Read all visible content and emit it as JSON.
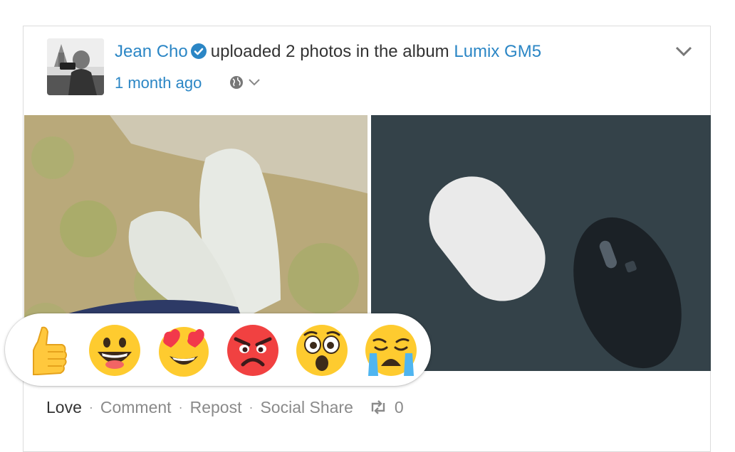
{
  "post": {
    "author": "Jean Cho",
    "action_text": "uploaded 2 photos in the album",
    "album": "Lumix GM5",
    "time": "1 month ago",
    "privacy_icon": "globe-icon"
  },
  "reactions": [
    "like",
    "haha",
    "love",
    "angry",
    "wow",
    "sad"
  ],
  "actions": {
    "love": "Love",
    "comment": "Comment",
    "repost": "Repost",
    "share": "Social Share",
    "repost_count": "0",
    "separator": "·"
  },
  "colors": {
    "link": "#2b86c5",
    "text": "#333333",
    "muted": "#8a8a8a",
    "verified": "#2b86c5"
  }
}
